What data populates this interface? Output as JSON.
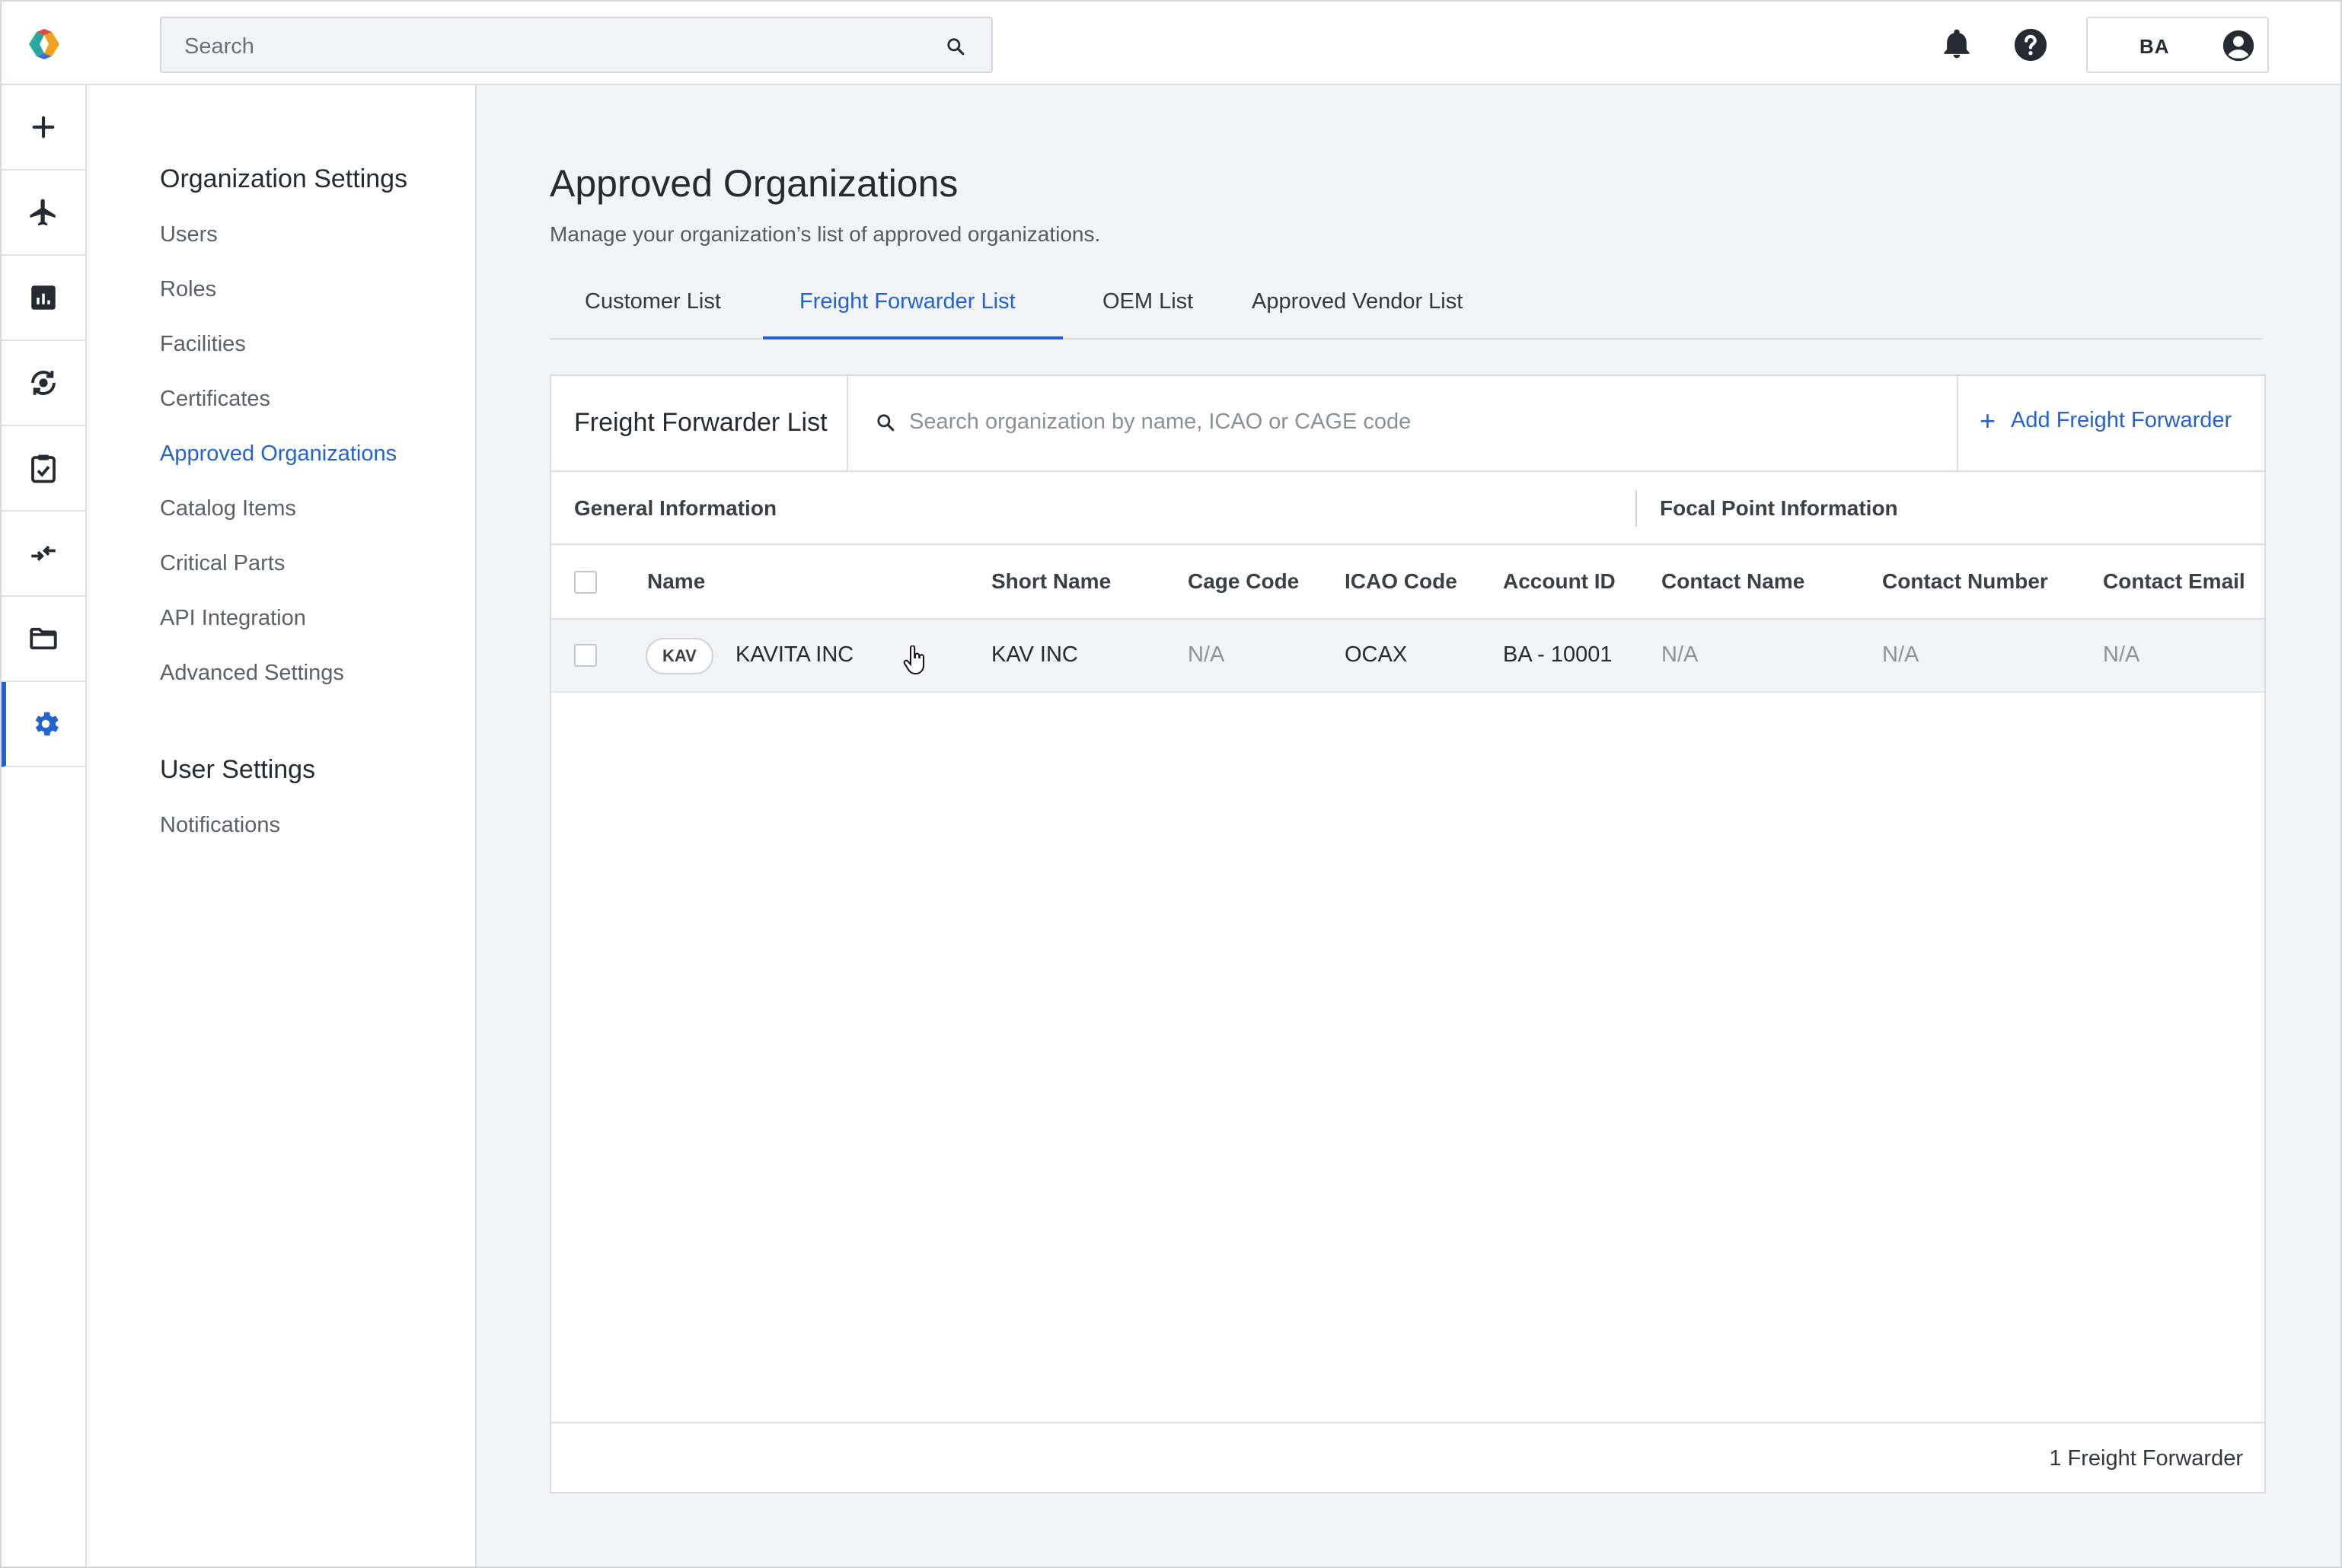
{
  "header": {
    "search_placeholder": "Search",
    "user_initials": "BA",
    "icons": [
      "logo",
      "search-icon",
      "bell-icon",
      "help-icon",
      "account-icon"
    ]
  },
  "rail": {
    "items": [
      {
        "icon": "plus-icon"
      },
      {
        "icon": "airplane-icon"
      },
      {
        "icon": "analytics-icon"
      },
      {
        "icon": "parts-exchange-icon"
      },
      {
        "icon": "clipboard-check-icon"
      },
      {
        "icon": "compare-arrows-icon"
      },
      {
        "icon": "folder-icon"
      },
      {
        "icon": "gear-icon",
        "active": true
      }
    ]
  },
  "settings_nav": {
    "org_heading": "Organization Settings",
    "org_links": [
      "Users",
      "Roles",
      "Facilities",
      "Certificates",
      "Approved Organizations",
      "Catalog Items",
      "Critical Parts",
      "API Integration",
      "Advanced Settings"
    ],
    "active_link": "Approved Organizations",
    "user_heading": "User Settings",
    "user_links": [
      "Notifications"
    ]
  },
  "page": {
    "title": "Approved Organizations",
    "subtitle": "Manage your organization’s list of approved organizations."
  },
  "tabs": [
    {
      "label": "Customer List"
    },
    {
      "label": "Freight Forwarder List",
      "active": true
    },
    {
      "label": "OEM List"
    },
    {
      "label": "Approved Vendor List"
    }
  ],
  "table_card": {
    "title": "Freight Forwarder List",
    "search_placeholder": "Search organization by name, ICAO or CAGE code",
    "add_button": "Add Freight Forwarder",
    "add_icon": "+",
    "groups": {
      "general": "General Information",
      "focal": "Focal Point Information"
    },
    "columns": [
      "Name",
      "Short Name",
      "Cage Code",
      "ICAO Code",
      "Account ID",
      "Contact Name",
      "Contact Number",
      "Contact Email"
    ],
    "rows": [
      {
        "badge": "KAV",
        "name": "KAVITA INC",
        "short_name": "KAV INC",
        "cage_code": "N/A",
        "icao_code": "OCAX",
        "account_id": "BA - 10001",
        "contact_name": "N/A",
        "contact_number": "N/A",
        "contact_email": "N/A"
      }
    ],
    "footer_count": "1 Freight Forwarder"
  },
  "colors": {
    "accent": "#2463cf",
    "page_bg": "#f2f3f6",
    "text": "#262a33",
    "muted": "#8d929b"
  }
}
